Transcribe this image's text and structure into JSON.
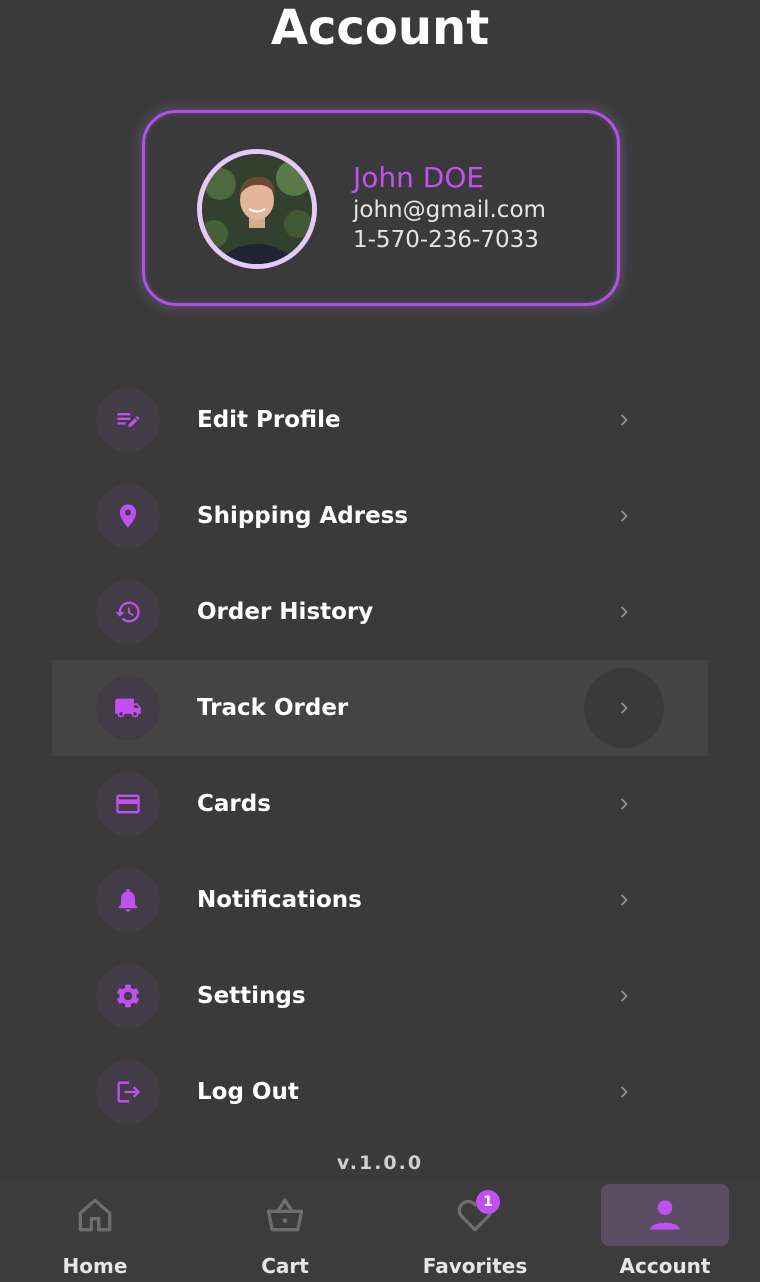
{
  "header": {
    "title": "Account"
  },
  "profile": {
    "name": "John DOE",
    "email": "john@gmail.com",
    "phone": "1-570-236-7033"
  },
  "menu": {
    "items": [
      {
        "label": "Edit Profile",
        "icon": "edit-note-icon"
      },
      {
        "label": "Shipping Adress",
        "icon": "location-pin-icon"
      },
      {
        "label": "Order History",
        "icon": "history-icon"
      },
      {
        "label": "Track Order",
        "icon": "truck-icon"
      },
      {
        "label": "Cards",
        "icon": "credit-card-icon"
      },
      {
        "label": "Notifications",
        "icon": "bell-icon"
      },
      {
        "label": "Settings",
        "icon": "gear-icon"
      },
      {
        "label": "Log Out",
        "icon": "logout-icon"
      }
    ]
  },
  "version": "v.1.0.0",
  "bottom_nav": {
    "items": [
      {
        "label": "Home",
        "icon": "home-icon"
      },
      {
        "label": "Cart",
        "icon": "basket-icon"
      },
      {
        "label": "Favorites",
        "icon": "heart-icon",
        "badge": "1"
      },
      {
        "label": "Account",
        "icon": "person-icon"
      }
    ],
    "active": "Account"
  },
  "colors": {
    "background": "#3a3a3a",
    "accent": "#c24ff0",
    "icon_circle": "#423c46",
    "active_nav_bg": "#5b4d63"
  }
}
